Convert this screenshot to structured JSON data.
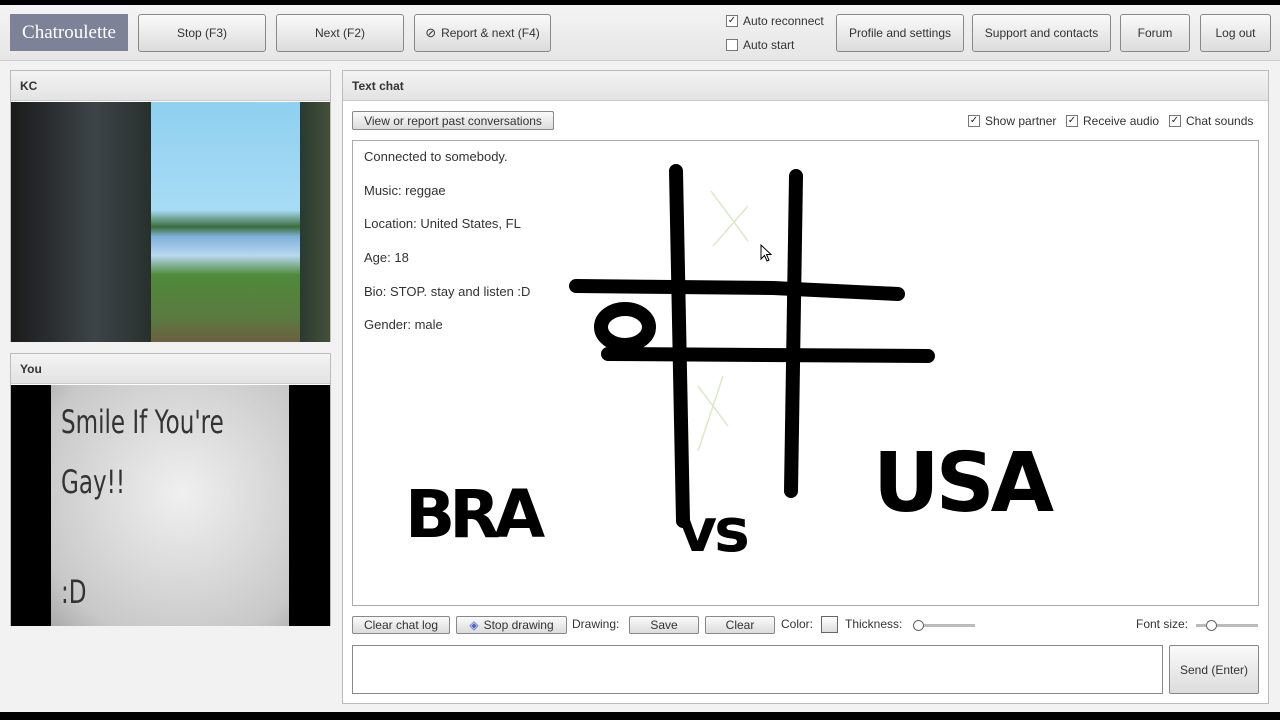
{
  "header": {
    "logo": "Chatroulette",
    "stop": "Stop (F3)",
    "next": "Next (F2)",
    "report": "Report & next (F4)",
    "auto_reconnect": "Auto reconnect",
    "auto_start": "Auto start",
    "profile": "Profile and settings",
    "support": "Support and contacts",
    "forum": "Forum",
    "logout": "Log out",
    "auto_reconnect_checked": true,
    "auto_start_checked": false
  },
  "partner": {
    "title": "KC"
  },
  "you": {
    "title": "You",
    "sign_lines": [
      "Smile If You're",
      "Gay!!",
      ":D"
    ]
  },
  "chat": {
    "title": "Text chat",
    "view_past": "View or report past conversations",
    "show_partner": "Show partner",
    "receive_audio": "Receive audio",
    "chat_sounds": "Chat sounds",
    "messages": [
      "Connected to somebody.",
      "Music: reggae",
      "Location: United States, FL",
      "Age: 18",
      "Bio: STOP. stay and listen :D",
      "Gender: male"
    ],
    "drawing_text": {
      "left": "BRA",
      "middle": "vs",
      "right": "USA"
    }
  },
  "toolbar": {
    "clear_log": "Clear chat log",
    "stop_drawing": "Stop drawing",
    "drawing": "Drawing:",
    "save": "Save",
    "clear": "Clear",
    "color": "Color:",
    "thickness": "Thickness:",
    "font_size": "Font size:",
    "send": "Send (Enter)",
    "thickness_value": 0,
    "font_size_value": 0.2
  },
  "input": {
    "value": ""
  }
}
